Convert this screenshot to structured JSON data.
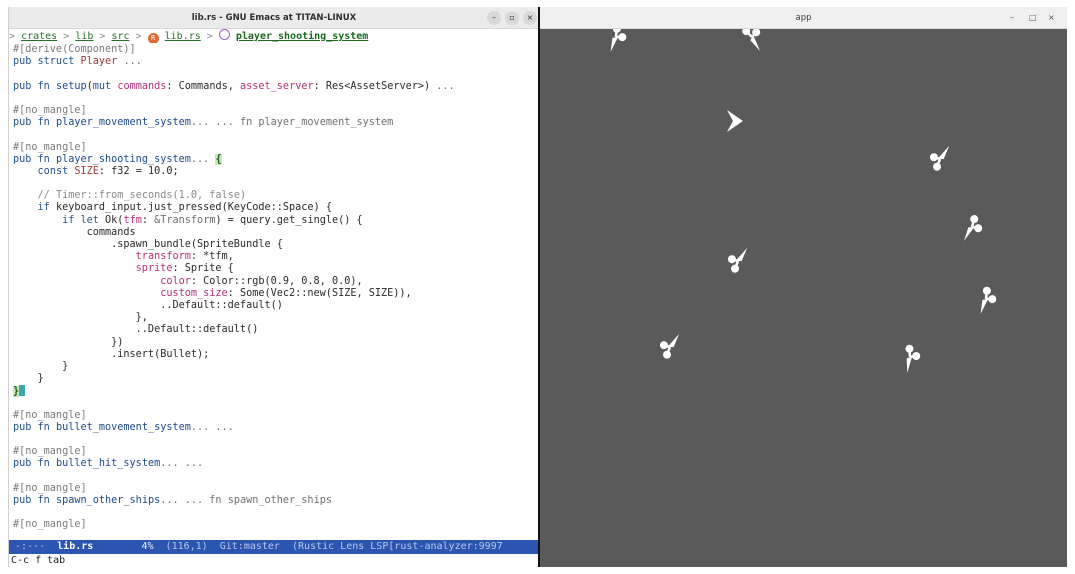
{
  "emacs": {
    "title": "lib.rs - GNU Emacs at TITAN-LINUX",
    "buttons": {
      "minimize": "–",
      "maximize": "▫",
      "close": "×"
    },
    "breadcrumb": {
      "lead": ">",
      "segments": [
        "crates",
        "lib",
        "src",
        "lib.rs"
      ],
      "current": "player_shooting_system",
      "separator": ">"
    },
    "modeline": {
      "status": "-:---",
      "buffer": "lib.rs",
      "percent": "4%",
      "position": "(116,1)",
      "vc": "Git:master",
      "modes": "(Rustic Lens LSP[rust-analyzer:9997"
    },
    "echo": "C-c f tab"
  },
  "app": {
    "title": "app",
    "buttons": {
      "minimize": "–",
      "maximize": "□",
      "close": "×"
    },
    "colors": {
      "background": "#5a5a5a",
      "ship": "#ffffff"
    },
    "entities": [
      {
        "kind": "ship",
        "rotation": 200
      },
      {
        "kind": "ship",
        "rotation": 150
      },
      {
        "kind": "player",
        "rotation": 0
      },
      {
        "kind": "ship",
        "rotation": 35
      },
      {
        "kind": "ship",
        "rotation": 210
      },
      {
        "kind": "ship",
        "rotation": 35
      },
      {
        "kind": "ship",
        "rotation": 200
      },
      {
        "kind": "ship",
        "rotation": 35
      },
      {
        "kind": "ship",
        "rotation": 190
      }
    ]
  }
}
